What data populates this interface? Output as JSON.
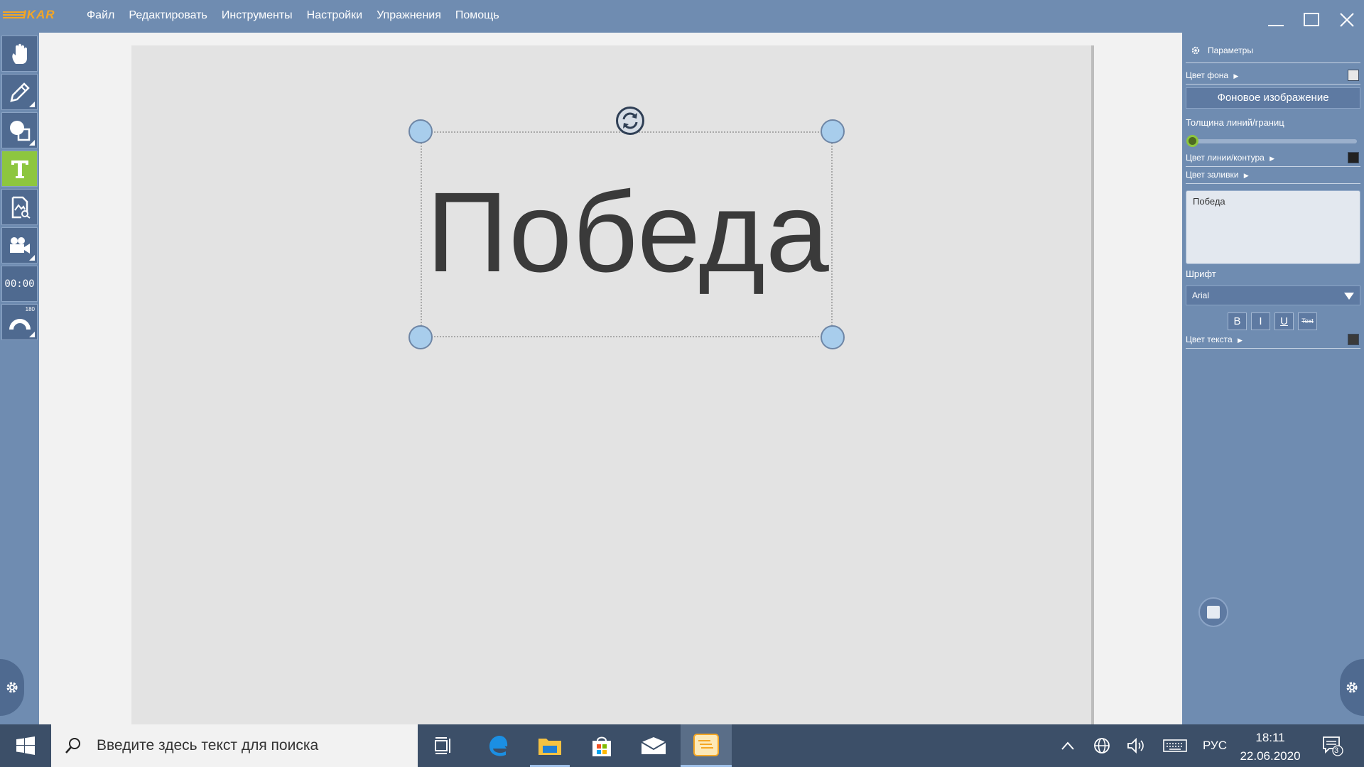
{
  "app": {
    "logo_text": "IKAR",
    "brand_color": "#f5a623"
  },
  "menu": [
    "Файл",
    "Редактировать",
    "Инструменты",
    "Настройки",
    "Упражнения",
    "Помощь"
  ],
  "window_controls": [
    "minimize-icon",
    "maximize-icon",
    "close-icon"
  ],
  "toolbar": {
    "tools": [
      {
        "name": "hand-icon",
        "active": false
      },
      {
        "name": "pen-icon",
        "active": false
      },
      {
        "name": "shapes-icon",
        "active": false
      },
      {
        "name": "text-icon",
        "active": true
      },
      {
        "name": "document-image-icon",
        "active": false
      },
      {
        "name": "video-camera-icon",
        "active": false
      },
      {
        "name": "timer",
        "label": "00:00",
        "active": false
      },
      {
        "name": "protractor-icon",
        "label": "180",
        "active": false
      }
    ],
    "active_color": "#8dc63f"
  },
  "canvas": {
    "text": "Победа"
  },
  "panel": {
    "title": "Параметры",
    "bg_color_label": "Цвет фона",
    "bg_image_button": "Фоновое изображение",
    "line_thickness_label": "Толщина линий/границ",
    "line_thickness_value": 0,
    "line_color_label": "Цвет линии/контура",
    "fill_color_label": "Цвет заливки",
    "text_content": "Победа",
    "font_label": "Шрифт",
    "font_value": "Arial",
    "style_buttons": [
      "B",
      "I",
      "U",
      "Text"
    ],
    "text_color_label": "Цвет текста",
    "bg_color_swatch": "#e8e8e8",
    "line_color_swatch": "#222222",
    "text_color_swatch": "#3a3a3a"
  },
  "taskbar": {
    "search_placeholder": "Введите здесь текст для поиска",
    "language": "РУС",
    "time": "18:11",
    "date": "22.06.2020",
    "notifications_count": "3"
  }
}
